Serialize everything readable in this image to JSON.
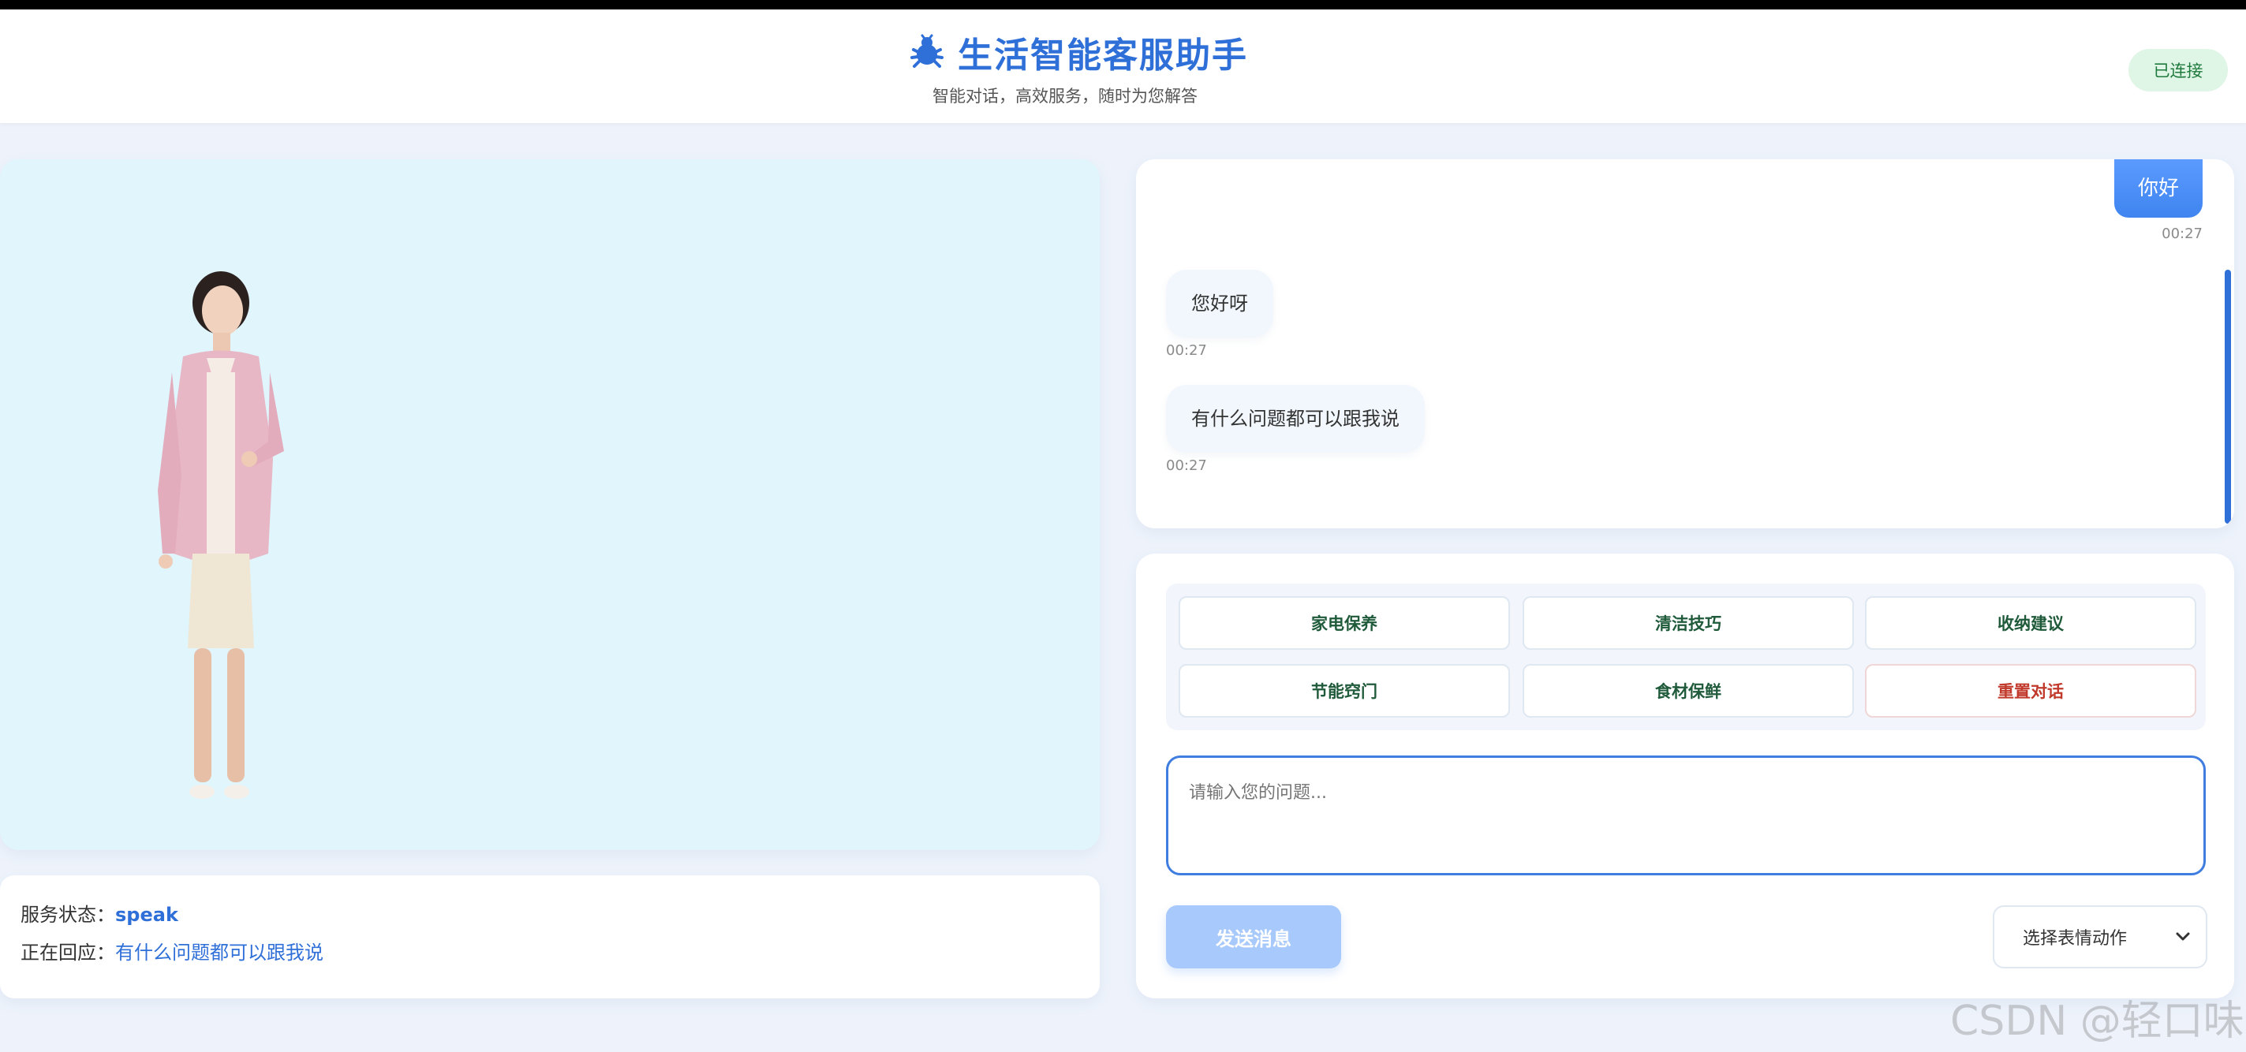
{
  "header": {
    "title": "生活智能客服助手",
    "subtitle": "智能对话，高效服务，随时为您解答",
    "connection_status": "已连接",
    "brand_icon": "bug-icon",
    "accent_color": "#2f6fd8"
  },
  "avatar": {
    "figure": "digital-human-avatar"
  },
  "info": {
    "service_status_label": "服务状态：",
    "service_status_value": "speak",
    "responding_label": "正在回应：",
    "responding_value": "有什么问题都可以跟我说"
  },
  "chat": {
    "messages": [
      {
        "role": "user",
        "text": "你好",
        "time": "00:27"
      },
      {
        "role": "bot",
        "text": "您好呀",
        "time": "00:27"
      },
      {
        "role": "bot",
        "text": "有什么问题都可以跟我说",
        "time": "00:27"
      }
    ]
  },
  "quick_actions": [
    {
      "label": "家电保养"
    },
    {
      "label": "清洁技巧"
    },
    {
      "label": "收纳建议"
    },
    {
      "label": "节能窍门"
    },
    {
      "label": "食材保鲜"
    },
    {
      "label": "重置对话"
    }
  ],
  "input": {
    "placeholder": "请输入您的问题...",
    "value": ""
  },
  "send_label": "发送消息",
  "expression_select": {
    "selected": "选择表情动作"
  },
  "watermark": "CSDN @轻口味"
}
